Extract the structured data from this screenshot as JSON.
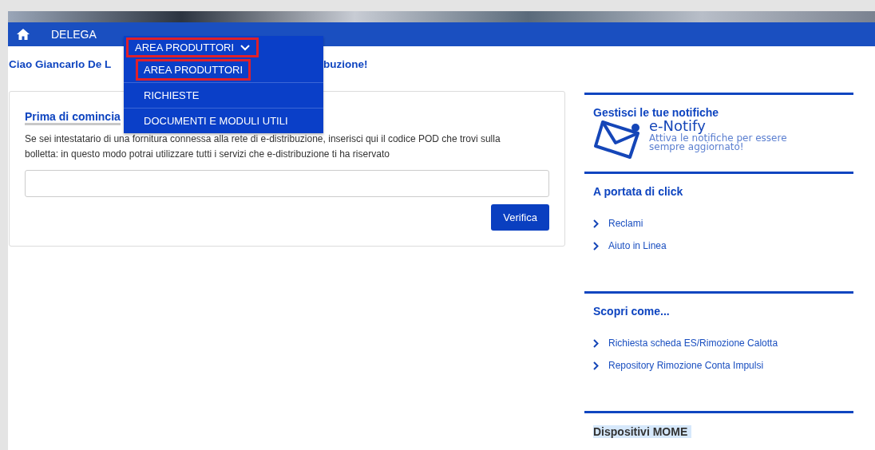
{
  "nav": {
    "items": [
      {
        "kind": "home"
      },
      {
        "kind": "link",
        "label": "DELEGA"
      }
    ]
  },
  "dropdown": {
    "label": "AREA PRODUTTORI",
    "expanded": true,
    "highlighted": true,
    "items": [
      {
        "label": "AREA PRODUTTORI",
        "highlighted": true
      },
      {
        "label": "RICHIESTE",
        "highlighted": false
      },
      {
        "label": "DOCUMENTI E MODULI UTILI",
        "highlighted": false
      }
    ]
  },
  "greeting": {
    "start": "Ciao Giancarlo De L",
    "end": "buzione!"
  },
  "pod_card": {
    "title": "Prima di comincia",
    "text": "Se sei intestatario di una fornitura connessa alla rete di e-distribuzione, inserisci qui il codice POD che trovi sulla bolletta: in questo modo potrai utilizzare tutti i servizi che e-distribuzione ti ha riservato",
    "button": "Verifica"
  },
  "sidebar": [
    {
      "kind": "notify",
      "title": "Gestisci le tue notifiche",
      "brand": "e-Notify",
      "text": "Attiva le notifiche per essere sempre aggiornato!"
    },
    {
      "kind": "links",
      "title": "A portata di click",
      "links": [
        "Reclami",
        "Aiuto in Linea"
      ]
    },
    {
      "kind": "links",
      "title": "Scopri come...",
      "links": [
        "Richiesta scheda ES/Rimozione Calotta",
        "Repository Rimozione Conta Impulsi"
      ]
    },
    {
      "kind": "heading",
      "title": "Dispositivi MOME"
    }
  ]
}
